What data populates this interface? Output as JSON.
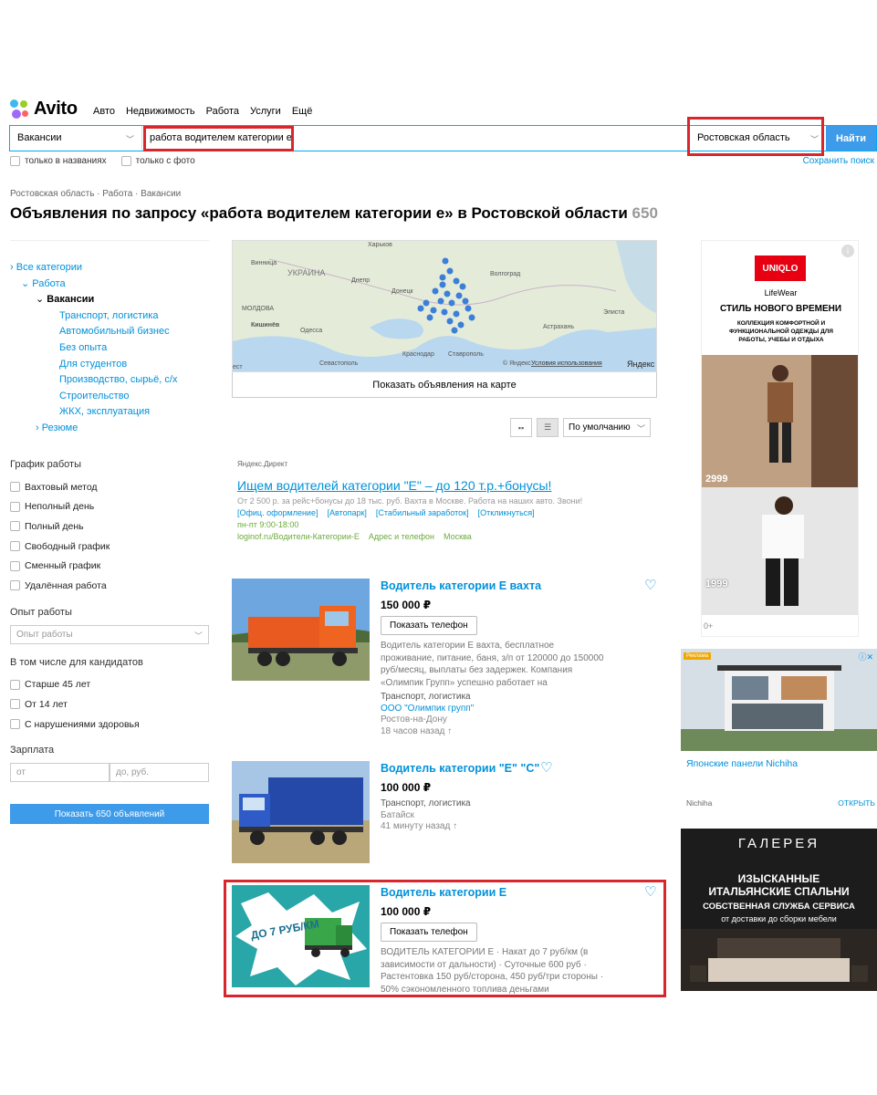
{
  "header": {
    "logo_text": "Avito",
    "nav": [
      "Авто",
      "Недвижимость",
      "Работа",
      "Услуги",
      "Ещё"
    ]
  },
  "search": {
    "category": "Вакансии",
    "query": "работа водителем категории е",
    "region": "Ростовская область",
    "submit_label": "Найти",
    "only_titles_label": "только в названиях",
    "only_photo_label": "только с фото",
    "save_search_label": "Сохранить поиск"
  },
  "breadcrumb": "Ростовская область · Работа · Вакансии",
  "page_title": "Объявления по запросу «работа водителем категории е» в Ростовской области",
  "result_count": "650",
  "sidebar": {
    "categories": [
      {
        "label": "Все категории",
        "level": 0,
        "marker": "›"
      },
      {
        "label": "Работа",
        "level": 1,
        "marker": "⌄"
      },
      {
        "label": "Вакансии",
        "level": 2,
        "marker": "⌄"
      },
      {
        "label": "Транспорт, логистика",
        "level": 3
      },
      {
        "label": "Автомобильный бизнес",
        "level": 3
      },
      {
        "label": "Без опыта",
        "level": 3
      },
      {
        "label": "Для студентов",
        "level": 3
      },
      {
        "label": "Производство, сырьё, с/х",
        "level": 3
      },
      {
        "label": "Строительство",
        "level": 3
      },
      {
        "label": "ЖКХ, эксплуатация",
        "level": 3
      },
      {
        "label": "Резюме",
        "level": 2,
        "marker": "›"
      }
    ],
    "schedule_title": "График работы",
    "schedule": [
      "Вахтовый метод",
      "Неполный день",
      "Полный день",
      "Свободный график",
      "Сменный график",
      "Удалённая работа"
    ],
    "experience_title": "Опыт работы",
    "experience_placeholder": "Опыт работы",
    "candidates_title": "В том числе для кандидатов",
    "candidates": [
      "Старше 45 лет",
      "От 14 лет",
      "С нарушениями здоровья"
    ],
    "salary_title": "Зарплата",
    "salary_from": "от",
    "salary_to": "до, руб.",
    "show_button": "Показать 650 объявлений"
  },
  "map": {
    "labels": [
      "Харьков",
      "Винница",
      "УКРАИНА",
      "Днепр",
      "Донецк",
      "Волгоград",
      "МОЛДОВА",
      "Кишинёв",
      "Одесса",
      "Астрахань",
      "Элиста",
      "Краснодар",
      "Ставрополь",
      "Севастополь",
      "ест"
    ],
    "copyright": "© Яндекс",
    "terms": "Условия использования",
    "brand": "Яндекс",
    "show_on_map": "Показать объявления на карте"
  },
  "sort": {
    "selected": "По умолчанию"
  },
  "direct_ad": {
    "label": "Яндекс.Директ",
    "title": "Ищем водителей категории \"Е\" – до 120 т.р.+бонусы!",
    "text": "От 2 500 р. за рейс+бонусы до 18 тыс. руб. Вахта в Москве. Работа на наших авто. Звони!",
    "links": [
      "[Офиц. оформление]",
      "[Автопарк]",
      "[Стабильный заработок]",
      "[Откликнуться]"
    ],
    "hours": "пн-пт 9:00-18:00",
    "domain": "loginof.ru/Водители-Категории-Е",
    "contacts": "Адрес и телефон",
    "city": "Москва"
  },
  "listings": [
    {
      "title": "Водитель категории Е вахта",
      "price": "150 000 ₽",
      "phone_button": "Показать телефон",
      "description": "Водитель категории Е вахта, бесплатное проживание, питание, баня, з/п от 120000 до 150000 руб/месяц, выплаты без задержек. Компания «Олимпик Групп» успешно работает на",
      "category": "Транспорт, логистика",
      "company": "ООО \"Олимпик групп\"",
      "location": "Ростов-на-Дону",
      "time": "18 часов назад"
    },
    {
      "title": "Водитель категории \"Е\" \"С\"",
      "price": "100 000 ₽",
      "category": "Транспорт, логистика",
      "location": "Батайск",
      "time": "41 минуту назад"
    },
    {
      "title": "Водитель категории Е",
      "price": "100 000 ₽",
      "phone_button": "Показать телефон",
      "description": "ВОДИТЕЛЬ КАТЕГОРИИ Е · Накат до 7 руб/км (в зависимости от дальности) · Суточные 600 руб · Растентовка 150 руб/сторона, 450 руб/три стороны · 50% сэкономленного топлива деньгами",
      "thumb_text": "ДО 7 РУБ/КМ"
    }
  ],
  "ads": {
    "uniqlo": {
      "brand": "UNIQLO",
      "sub": "LifeWear",
      "headline": "СТИЛЬ НОВОГО ВРЕМЕНИ",
      "text": "КОЛЛЕКЦИЯ КОМФОРТНОЙ И ФУНКЦИОНАЛЬНОЙ ОДЕЖДЫ ДЛЯ РАБОТЫ, УЧЕБЫ И ОТДЫХА",
      "price1": "2999",
      "price2": "1999",
      "age": "0+"
    },
    "nichiha": {
      "badge": "Реклама",
      "title": "Японские панели Nichiha",
      "source": "Nichiha",
      "cta": "ОТКРЫТЬ"
    },
    "galereya": {
      "brand": "ГАЛЕРЕЯ",
      "line1": "ИЗЫСКАННЫЕ",
      "line2": "ИТАЛЬЯНСКИЕ СПАЛЬНИ",
      "line3": "СОБСТВЕННАЯ СЛУЖБА СЕРВИСА",
      "line4": "от доставки до сборки мебели"
    }
  },
  "colors": {
    "accent": "#0091d9",
    "button": "#3d9be9",
    "highlight": "#d9262c"
  }
}
